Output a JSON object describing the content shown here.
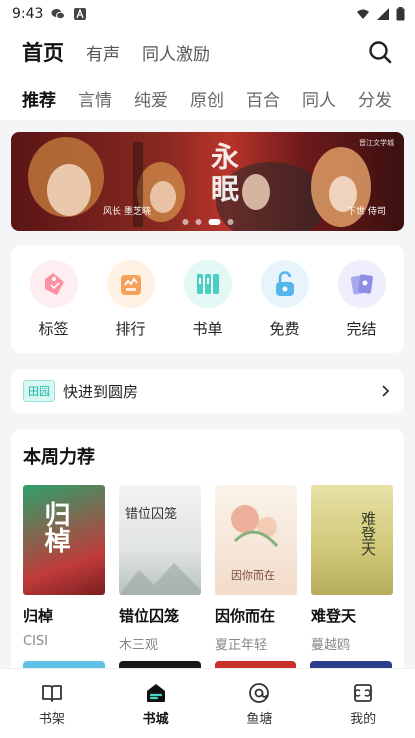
{
  "status_bar": {
    "time": "9:43"
  },
  "top_nav": {
    "tabs": [
      "首页",
      "有声",
      "同人激励"
    ],
    "active": 0
  },
  "categories": [
    "推荐",
    "言情",
    "纯爱",
    "原创",
    "百合",
    "同人",
    "分发"
  ],
  "banner": {
    "title": "永眠",
    "left_caption": "风长  墨芝晓",
    "right_caption": "下世  侍司",
    "brand": "晋江文学城",
    "dots": 4,
    "active_dot": 2
  },
  "quick_entries": [
    {
      "label": "标签",
      "icon": "tag-icon",
      "color": "#ff8fa3",
      "bg": "#ffeef1"
    },
    {
      "label": "排行",
      "icon": "ranking-icon",
      "color": "#f6a25a",
      "bg": "#fff2e4"
    },
    {
      "label": "书单",
      "icon": "booklist-icon",
      "color": "#4ccfc2",
      "bg": "#e4f8f6"
    },
    {
      "label": "免费",
      "icon": "unlock-icon",
      "color": "#55b6ec",
      "bg": "#e7f4fc"
    },
    {
      "label": "完结",
      "icon": "cards-icon",
      "color": "#8f8ee6",
      "bg": "#eeeefc"
    }
  ],
  "fast_track": {
    "tag": "田园",
    "text": "快进到圆房"
  },
  "weekly": {
    "title": "本周力荐",
    "books": [
      {
        "name": "归棹",
        "author": "CISI",
        "cover_text": "归棹"
      },
      {
        "name": "错位囚笼",
        "author": "木三观",
        "cover_text": "错位囚笼"
      },
      {
        "name": "因你而在",
        "author": "夏正年轻",
        "cover_text": "因你而在"
      },
      {
        "name": "难登天",
        "author": "蔓越鸥",
        "cover_text": "难登天"
      }
    ]
  },
  "bottom_nav": {
    "items": [
      "书架",
      "书城",
      "鱼塘",
      "我的"
    ],
    "active": 1
  }
}
